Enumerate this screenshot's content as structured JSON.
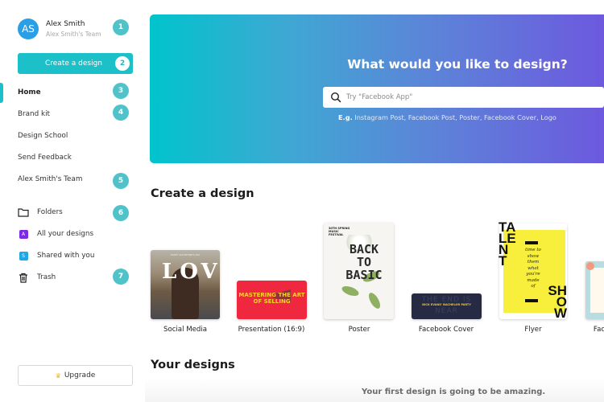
{
  "sidebar": {
    "user": {
      "initials": "AS",
      "name": "Alex Smith",
      "team": "Alex Smith's Team",
      "avatar_color": "#2a9fe5"
    },
    "create_button": "Create a design",
    "nav": [
      {
        "label": "Home",
        "active": true
      },
      {
        "label": "Brand kit"
      },
      {
        "label": "Design School"
      },
      {
        "label": "Send Feedback"
      },
      {
        "label": "Alex Smith's Team"
      }
    ],
    "folders": [
      {
        "label": "Folders",
        "icon": "folder-icon"
      },
      {
        "label": "All your designs",
        "icon": "all-designs-icon",
        "letter": "A",
        "color": "#7d2ae8"
      },
      {
        "label": "Shared with you",
        "icon": "shared-icon",
        "letter": "S",
        "color": "#1ea7e4"
      },
      {
        "label": "Trash",
        "icon": "trash-icon"
      }
    ],
    "upgrade_button": "Upgrade",
    "upgrade_icon": "♛"
  },
  "badges": [
    "1",
    "2",
    "3",
    "4",
    "5",
    "6",
    "7"
  ],
  "hero": {
    "title": "What would you like to design?",
    "search_placeholder": "Try \"Facebook App\"",
    "search_value": "",
    "examples_prefix": "E.g.",
    "examples": "Instagram Post, Facebook Post, Poster, Facebook Cover, Logo"
  },
  "create_section": {
    "title": "Create a design",
    "cards": [
      {
        "label": "Social Media",
        "art_text": "LOVE"
      },
      {
        "label": "Presentation (16:9)",
        "art_text": "MASTERING THE ART OF SELLING"
      },
      {
        "label": "Poster",
        "art_text": "BACK TO BASIC",
        "art_header": "30TH SPRING MUSIC FESTIVAL"
      },
      {
        "label": "Facebook Cover",
        "art_text": "NICK EVANS' BACHELOR PARTY",
        "art_bg": "THE END IS NEAR"
      },
      {
        "label": "Flyer",
        "art_text_top": "TALENT",
        "art_text_bottom": "SHOW",
        "art_quote": "time to show them what you're made of"
      },
      {
        "label": "Fac"
      }
    ]
  },
  "your_designs": {
    "title": "Your designs",
    "empty_message": "Your first design is going to be amazing."
  }
}
